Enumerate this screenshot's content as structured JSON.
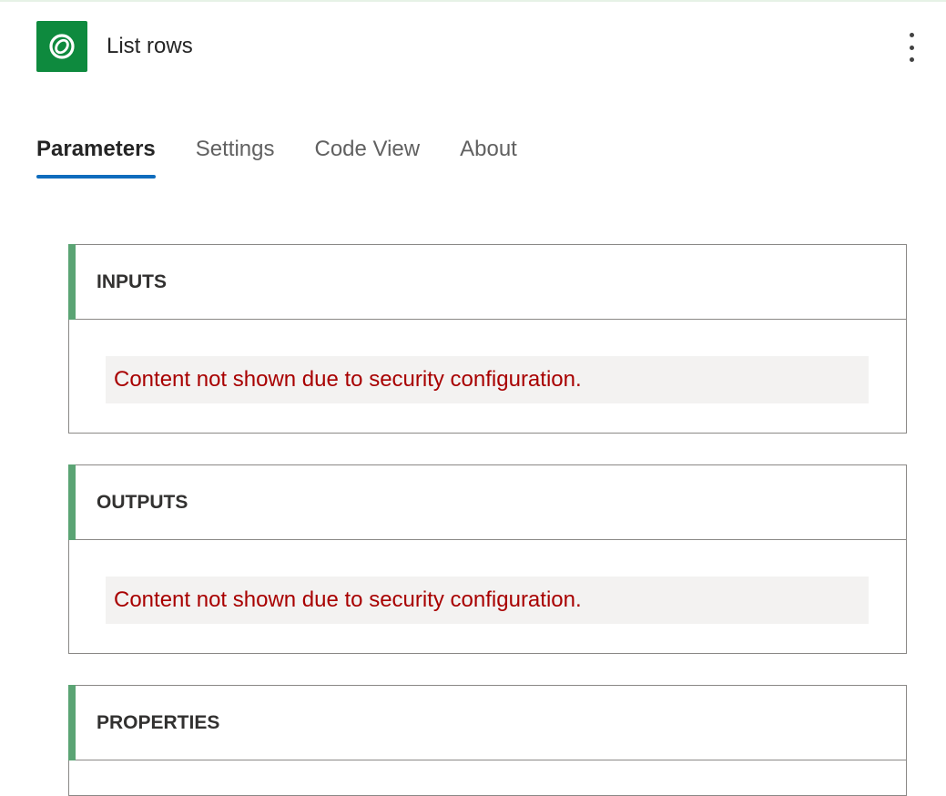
{
  "header": {
    "title": "List rows",
    "icon": "dataverse-icon",
    "icon_bg": "#0e8a3e",
    "more_icon": "more-vertical-icon"
  },
  "tabs": [
    {
      "label": "Parameters",
      "active": true
    },
    {
      "label": "Settings",
      "active": false
    },
    {
      "label": "Code View",
      "active": false
    },
    {
      "label": "About",
      "active": false
    }
  ],
  "accent_color": "#0f6cbd",
  "sections": {
    "inputs": {
      "title": "INPUTS",
      "message": "Content not shown due to security configuration."
    },
    "outputs": {
      "title": "OUTPUTS",
      "message": "Content not shown due to security configuration."
    },
    "properties": {
      "title": "PROPERTIES"
    }
  },
  "colors": {
    "section_accent": "#5ba474",
    "error_text": "#a80000",
    "message_bg": "#f3f2f1"
  }
}
